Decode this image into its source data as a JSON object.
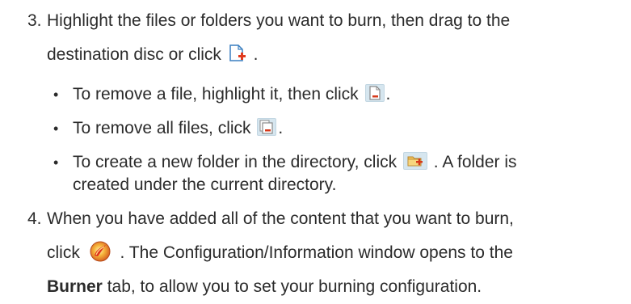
{
  "steps": [
    {
      "number": "3.",
      "line1": "Highlight the files or folders you want to burn, then drag to the",
      "line2_before": "destination disc or click",
      "line2_after": " .",
      "icon": "add-file-icon",
      "bullets": [
        {
          "before": "To remove a file, highlight it, then click",
          "after": ".",
          "icon": "remove-file-icon"
        },
        {
          "before": "To remove all files, click",
          "after": ".",
          "icon": "remove-all-files-icon"
        },
        {
          "before": "To create a new folder in the directory, click",
          "after": " . A folder is",
          "icon": "new-folder-icon",
          "line2": "created under the current directory."
        }
      ]
    },
    {
      "number": "4.",
      "line1": "When you have added all of the content that you want to burn,",
      "line2_before": "click",
      "line2_after": " . The Configuration/Information window opens to the",
      "icon": "burn-icon",
      "line3_bold": "Burner",
      "line3_rest": " tab, to allow you to set your burning configuration."
    }
  ]
}
